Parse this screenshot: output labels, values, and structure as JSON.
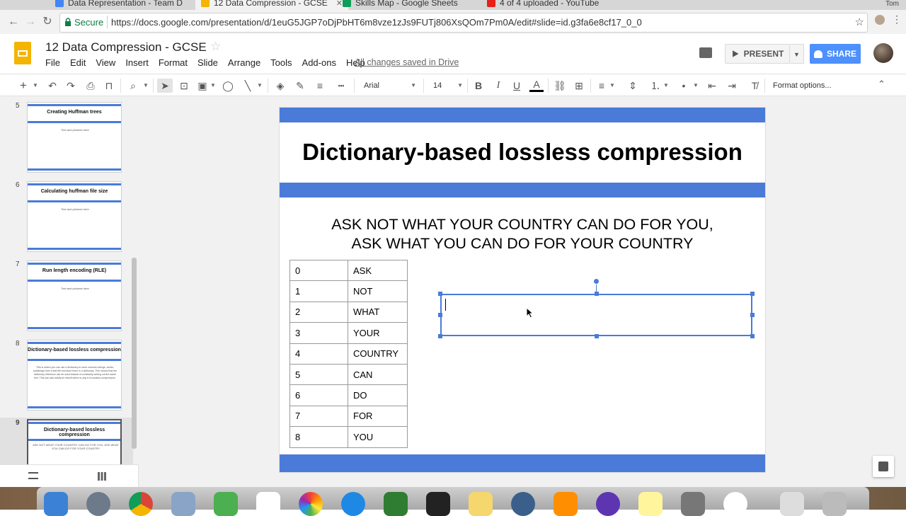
{
  "browser": {
    "tabs": [
      {
        "label": "Data Representation - Team D",
        "icon_color": "#4285f4"
      },
      {
        "label": "12 Data Compression - GCSE",
        "icon_color": "#f4b400",
        "active": true
      },
      {
        "label": "Skills Map - Google Sheets",
        "icon_color": "#0f9d58"
      },
      {
        "label": "4 of 4 uploaded - YouTube",
        "icon_color": "#e62117"
      }
    ],
    "profile_name": "Tom",
    "secure_label": "Secure",
    "url": "https://docs.google.com/presentation/d/1euG5JGP7oDjPbHT6m8vze1zJs9FUTj806XsQOm7Pm0A/edit#slide=id.g3fa6e8cf17_0_0"
  },
  "header": {
    "title": "12 Data Compression - GCSE",
    "menu": [
      "File",
      "Edit",
      "View",
      "Insert",
      "Format",
      "Slide",
      "Arrange",
      "Tools",
      "Add-ons",
      "Help"
    ],
    "saved_status": "All changes saved in Drive",
    "present_label": "PRESENT",
    "share_label": "SHARE"
  },
  "toolbar": {
    "font": "Arial",
    "font_size": "14",
    "format_options": "Format options..."
  },
  "filmstrip": {
    "slides": [
      {
        "num": "5",
        "title": "Creating Huffman trees",
        "body": "Text and pictures here"
      },
      {
        "num": "6",
        "title": "Calculating huffman file size",
        "body": "Text and pictures here"
      },
      {
        "num": "7",
        "title": "Run length encoding (RLE)",
        "body": "Text and pictures here"
      },
      {
        "num": "8",
        "title": "Dictionary-based lossless compression",
        "body": "This is where you can use a dictionary to store common strings, words, substrings from a text file and store them in a dictionary. This means that the dictionary reference can be used instead of constantly writing out the same text. This can also easily be rebuilt which is why it is lossless compression."
      },
      {
        "num": "9",
        "title": "Dictionary-based lossless compression",
        "body": "ASK NOT WHAT YOUR COUNTRY CAN DO FOR YOU, ASK WHAT YOU CAN DO FOR YOUR COUNTRY"
      }
    ]
  },
  "slide": {
    "title": "Dictionary-based lossless compression",
    "quote_line1": "ASK NOT WHAT YOUR COUNTRY CAN DO FOR YOU,",
    "quote_line2": "ASK WHAT YOU CAN DO FOR YOUR COUNTRY",
    "table": [
      [
        "0",
        "ASK"
      ],
      [
        "1",
        "NOT"
      ],
      [
        "2",
        "WHAT"
      ],
      [
        "3",
        "YOUR"
      ],
      [
        "4",
        "COUNTRY"
      ],
      [
        "5",
        "CAN"
      ],
      [
        "6",
        "DO"
      ],
      [
        "7",
        "FOR"
      ],
      [
        "8",
        "YOU"
      ]
    ]
  },
  "colors": {
    "slide_accent": "#4a7bd8",
    "share_button": "#4d90fe",
    "slides_logo": "#f4b400",
    "secure_green": "#0b8043"
  }
}
